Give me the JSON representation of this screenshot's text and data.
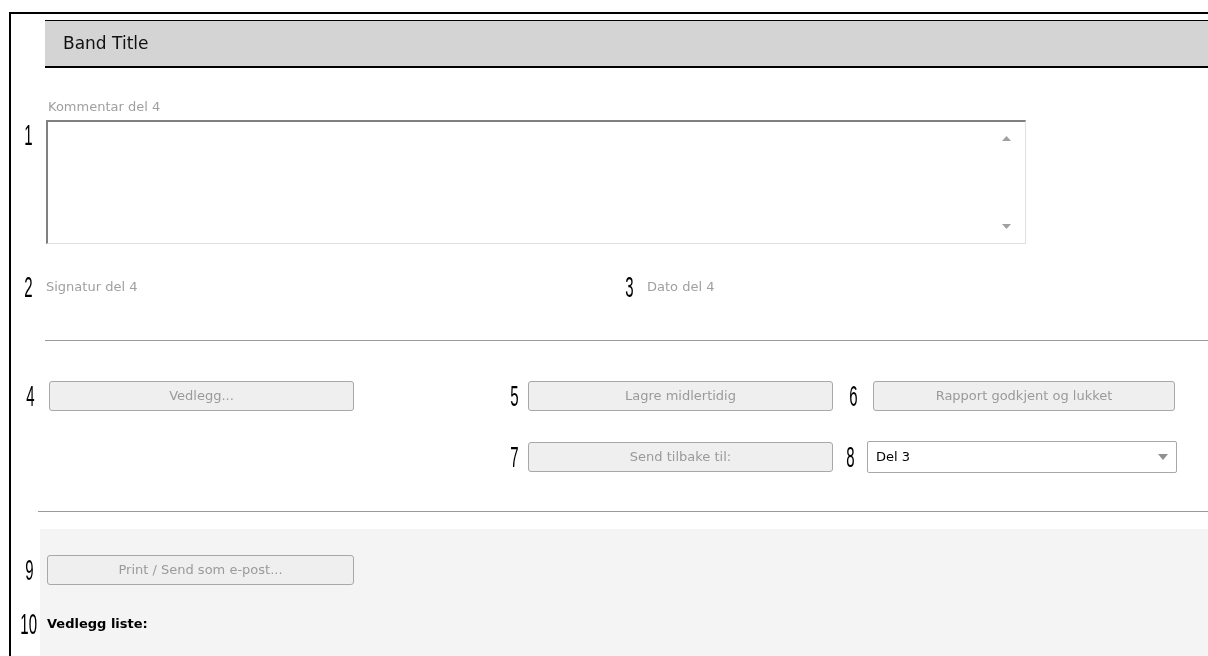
{
  "band_title": "Band Title",
  "comment": {
    "callout": "1",
    "label": "Kommentar del 4"
  },
  "signature": {
    "callout": "2",
    "label": "Signatur del 4"
  },
  "date": {
    "callout": "3",
    "label": "Dato del 4"
  },
  "attachment_button": {
    "callout": "4",
    "label": "Vedlegg...",
    "disabled": true
  },
  "save_button": {
    "callout": "5",
    "label": "Lagre midlertidig",
    "disabled": true
  },
  "approve_button": {
    "callout": "6",
    "label": "Rapport godkjent og lukket",
    "disabled": true
  },
  "send_back_button": {
    "callout": "7",
    "label": "Send tilbake til:",
    "disabled": true
  },
  "send_back_select": {
    "callout": "8",
    "value": "Del 3"
  },
  "print_button": {
    "callout": "9",
    "label": "Print / Send som e-post...",
    "disabled": true
  },
  "attachment_list": {
    "callout": "10",
    "label": "Vedlegg liste:"
  }
}
